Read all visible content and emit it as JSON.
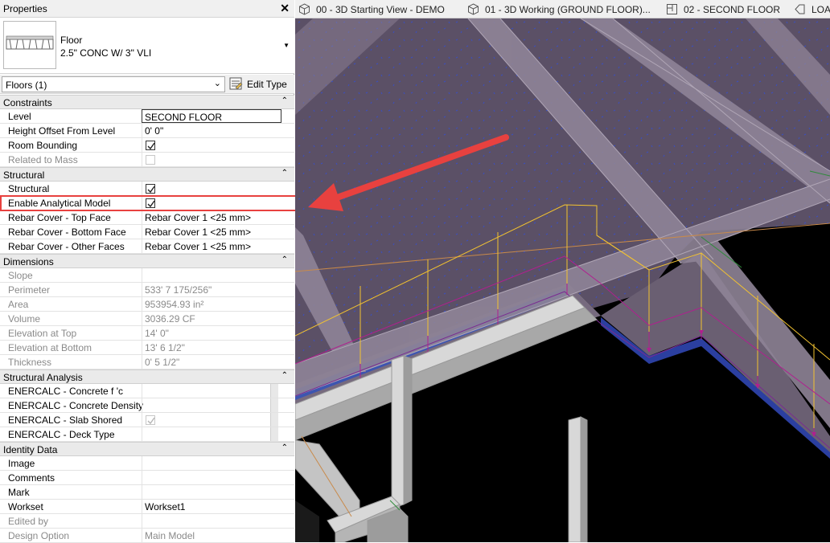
{
  "palette": {
    "title": "Properties",
    "close_glyph": "✕",
    "type_family": "Floor",
    "type_name": "2.5\" CONC W/ 3\" VLI",
    "instance_filter": "Floors (1)",
    "edit_type_label": "Edit Type"
  },
  "groups": {
    "constraints": "Constraints",
    "structural": "Structural",
    "dimensions": "Dimensions",
    "structural_analysis": "Structural Analysis",
    "identity_data": "Identity Data",
    "collapse_glyph": "⌃"
  },
  "rows": {
    "level": {
      "label": "Level",
      "value": "SECOND FLOOR"
    },
    "height_offset": {
      "label": "Height Offset From Level",
      "value": "0'  0\""
    },
    "room_bounding": {
      "label": "Room Bounding",
      "checked": true
    },
    "related_mass": {
      "label": "Related to Mass",
      "checked": false
    },
    "structural": {
      "label": "Structural",
      "checked": true
    },
    "enable_analytical": {
      "label": "Enable Analytical Model",
      "checked": true
    },
    "rebar_top": {
      "label": "Rebar Cover - Top Face",
      "value": "Rebar Cover 1 <25 mm>"
    },
    "rebar_bottom": {
      "label": "Rebar Cover - Bottom Face",
      "value": "Rebar Cover 1 <25 mm>"
    },
    "rebar_other": {
      "label": "Rebar Cover - Other Faces",
      "value": "Rebar Cover 1 <25 mm>"
    },
    "slope": {
      "label": "Slope",
      "value": ""
    },
    "perimeter": {
      "label": "Perimeter",
      "value": "533'  7 175/256\""
    },
    "area": {
      "label": "Area",
      "value": "953954.93 in²"
    },
    "volume": {
      "label": "Volume",
      "value": "3036.29 CF"
    },
    "elev_top": {
      "label": "Elevation at Top",
      "value": "14'  0\""
    },
    "elev_bottom": {
      "label": "Elevation at Bottom",
      "value": "13'  6 1/2\""
    },
    "thickness": {
      "label": "Thickness",
      "value": "0'  5 1/2\""
    },
    "enercalc_fc": {
      "label": "ENERCALC - Concrete f 'c",
      "value": ""
    },
    "enercalc_density": {
      "label": "ENERCALC - Concrete Density",
      "value": ""
    },
    "enercalc_shored": {
      "label": "ENERCALC - Slab Shored",
      "checked": true
    },
    "enercalc_deck": {
      "label": "ENERCALC - Deck Type",
      "value": ""
    },
    "image": {
      "label": "Image",
      "value": ""
    },
    "comments": {
      "label": "Comments",
      "value": ""
    },
    "mark": {
      "label": "Mark",
      "value": ""
    },
    "workset": {
      "label": "Workset",
      "value": "Workset1"
    },
    "edited_by": {
      "label": "Edited by",
      "value": ""
    },
    "design_option": {
      "label": "Design Option",
      "value": "Main Model"
    }
  },
  "tabs": [
    {
      "label": "00 - 3D Starting View - DEMO",
      "icon": "cube-icon"
    },
    {
      "label": "01 - 3D Working (GROUND FLOOR)...",
      "icon": "cube-icon"
    },
    {
      "label": "02 - SECOND FLOOR",
      "icon": "floor-plan-icon"
    },
    {
      "label": "LOA",
      "icon": "view-icon"
    }
  ],
  "colors": {
    "highlight": "#e8413f",
    "slab": "#5d5266",
    "beam": "#8c8090",
    "analytical_yellow": "#f2c230",
    "analytical_magenta": "#b0208f",
    "edge_blue": "#2b3fa0"
  }
}
